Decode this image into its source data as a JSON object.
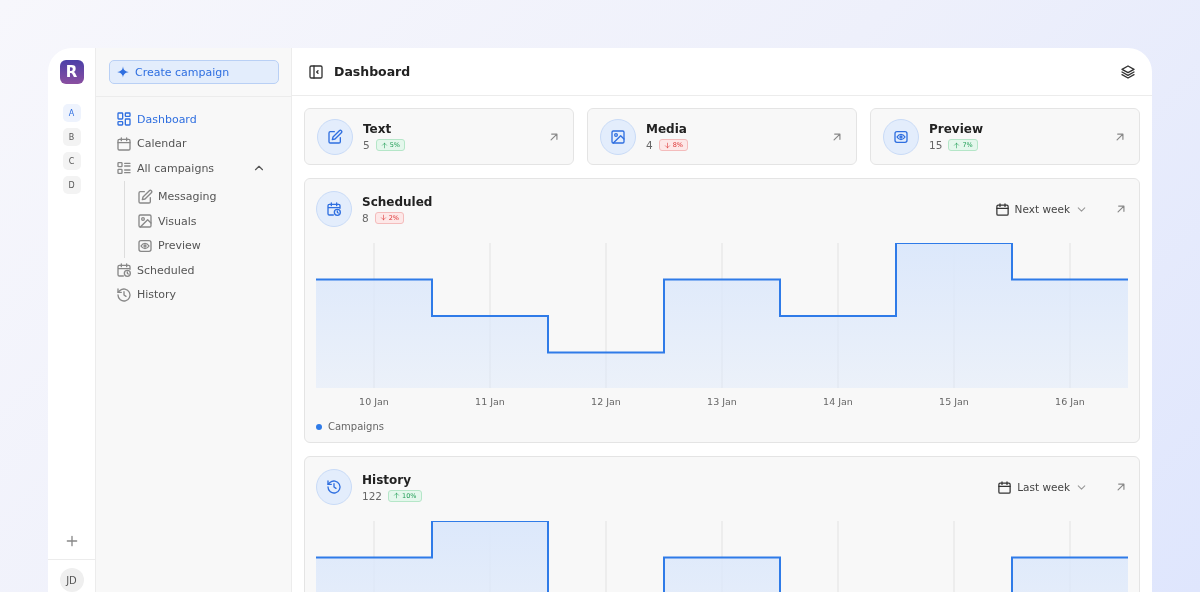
{
  "logo": "R",
  "workspaces": [
    {
      "label": "A",
      "selected": true
    },
    {
      "label": "B",
      "selected": false
    },
    {
      "label": "C",
      "selected": false
    },
    {
      "label": "D",
      "selected": false
    }
  ],
  "user": {
    "initials": "JD"
  },
  "sidebar": {
    "create_button": "Create campaign",
    "items": [
      {
        "label": "Dashboard",
        "selected": true
      },
      {
        "label": "Calendar",
        "selected": false
      },
      {
        "label": "All campaigns",
        "selected": false,
        "expanded": true,
        "children": [
          {
            "label": "Messaging",
            "selected": false
          },
          {
            "label": "Visuals",
            "selected": false
          },
          {
            "label": "Preview",
            "selected": false
          }
        ]
      },
      {
        "label": "Scheduled",
        "selected": false
      },
      {
        "label": "History",
        "selected": false
      }
    ]
  },
  "header": {
    "title": "Dashboard"
  },
  "stat_cards": [
    {
      "title": "Text",
      "value": "5",
      "change": {
        "kind": "up",
        "label": "5%"
      }
    },
    {
      "title": "Media",
      "value": "4",
      "change": {
        "kind": "down",
        "label": "8%"
      }
    },
    {
      "title": "Preview",
      "value": "15",
      "change": {
        "kind": "up",
        "label": "7%"
      }
    }
  ],
  "chart_cards": [
    {
      "title": "Scheduled",
      "value": "8",
      "change": {
        "kind": "down",
        "label": "2%"
      },
      "period": "Next week",
      "x_labels": [
        "10 Jan",
        "11 Jan",
        "12 Jan",
        "13 Jan",
        "14 Jan",
        "15 Jan",
        "16 Jan"
      ],
      "legend": "Campaigns"
    },
    {
      "title": "History",
      "value": "122",
      "change": {
        "kind": "up",
        "label": "10%"
      },
      "period": "Last week"
    }
  ]
}
